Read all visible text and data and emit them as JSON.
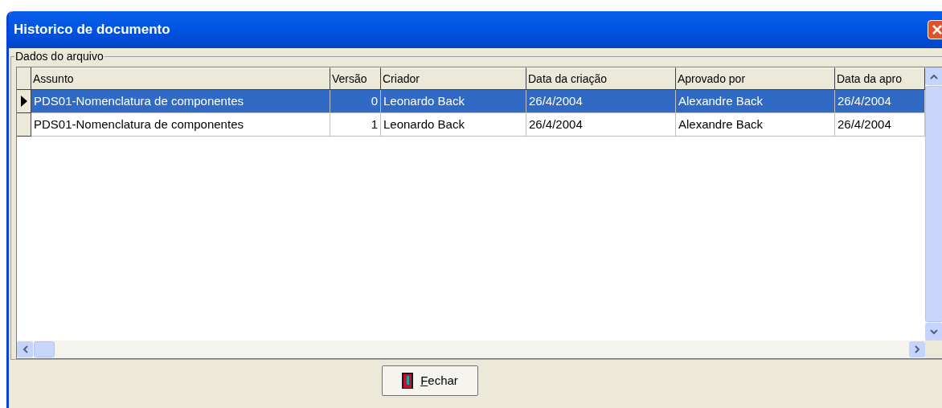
{
  "window": {
    "title": "Historico de documento"
  },
  "group": {
    "label": "Dados do arquivo"
  },
  "table": {
    "columns": [
      "Assunto",
      "Versão",
      "Criador",
      "Data da criação",
      "Aprovado por",
      "Data da apro"
    ],
    "rows": [
      {
        "selected": true,
        "cells": [
          "PDS01-Nomenclatura de componentes",
          "0",
          "Leonardo Back",
          "26/4/2004",
          "Alexandre Back",
          "26/4/2004"
        ]
      },
      {
        "selected": false,
        "cells": [
          "PDS01-Nomenclatura de componentes",
          "1",
          "Leonardo Back",
          "26/4/2004",
          "Alexandre Back",
          "26/4/2004"
        ]
      }
    ]
  },
  "buttons": [
    {
      "label": "Fechar",
      "mnemonic_underlined": true
    }
  ]
}
